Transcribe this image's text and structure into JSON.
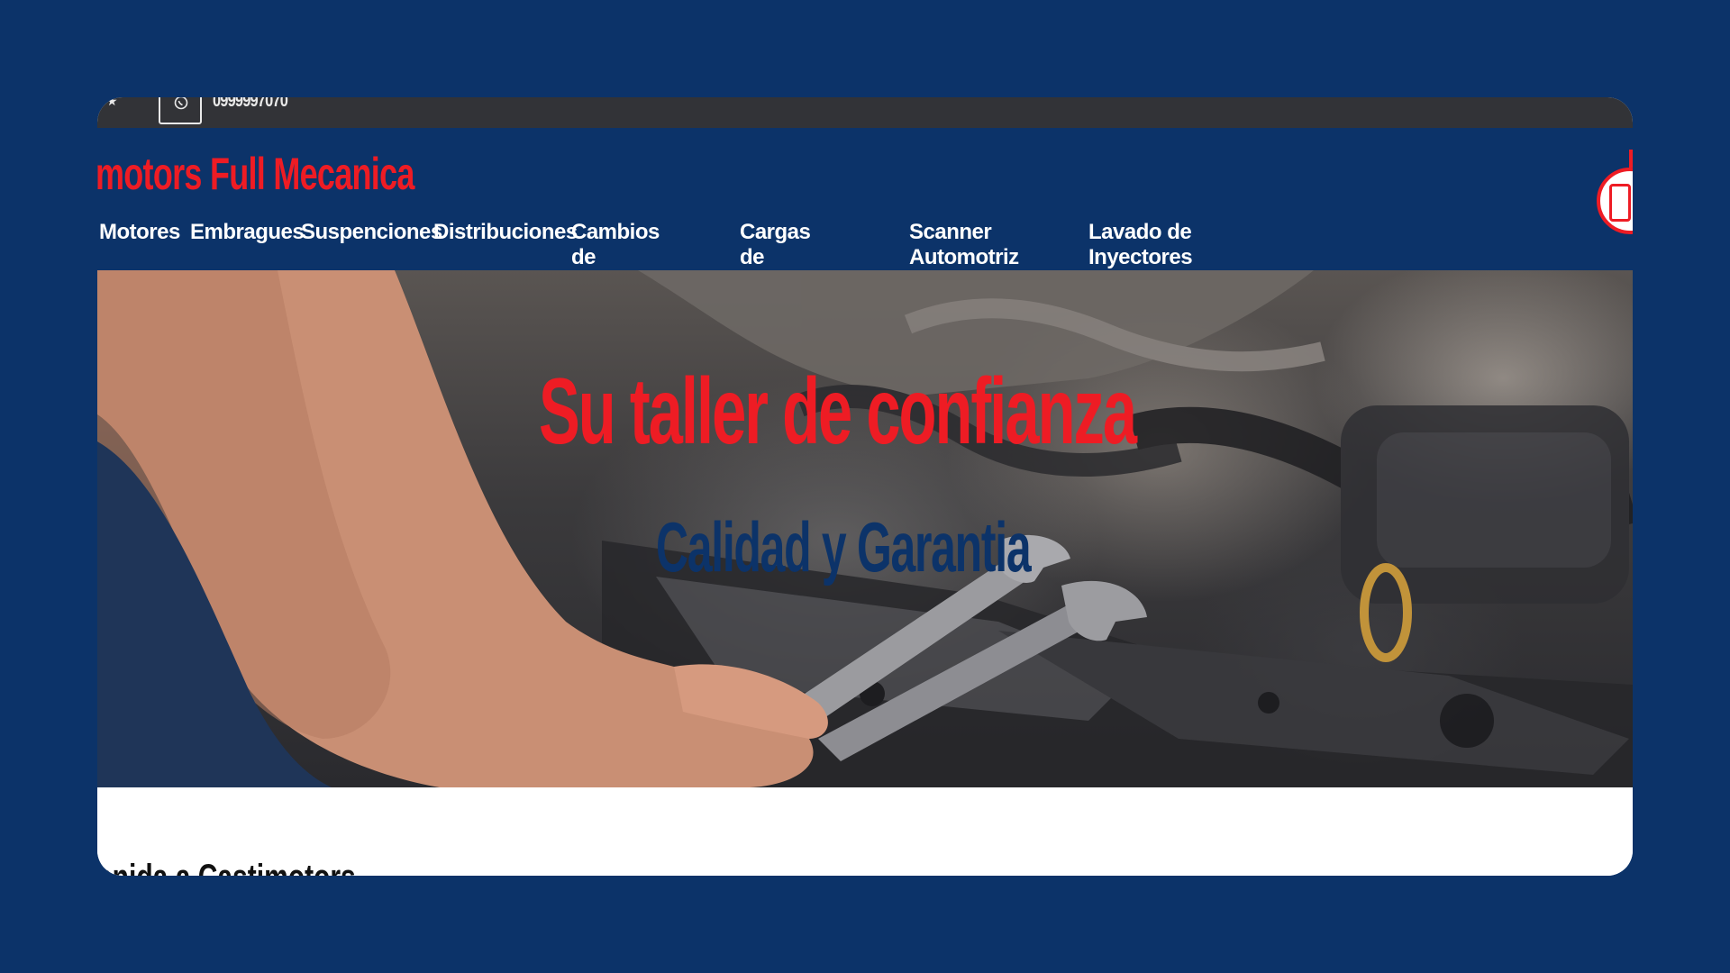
{
  "topbar": {
    "phone": "0999997070"
  },
  "header": {
    "brand": "motors Full Mecanica",
    "nav": [
      "Motores",
      "Embragues",
      "Suspenciones",
      "Distribuciones",
      "Cambios de Aceite",
      "Cargas de Baterias",
      "Scanner Automotriz",
      "Lavado de Inyectores"
    ]
  },
  "hero": {
    "title": "Su taller de confianza",
    "subtitle": "Calidad y Garantia"
  },
  "below": {
    "heading_partial": "enida a Castimotors"
  },
  "icons": {
    "whatsapp": "whatsapp-icon",
    "star": "star-icon",
    "logo": "brand-logo"
  },
  "colors": {
    "page_bg": "#0c3369",
    "brand_red": "#ee1c24",
    "topbar_bg": "#323337",
    "nav_text": "#ffffff"
  }
}
